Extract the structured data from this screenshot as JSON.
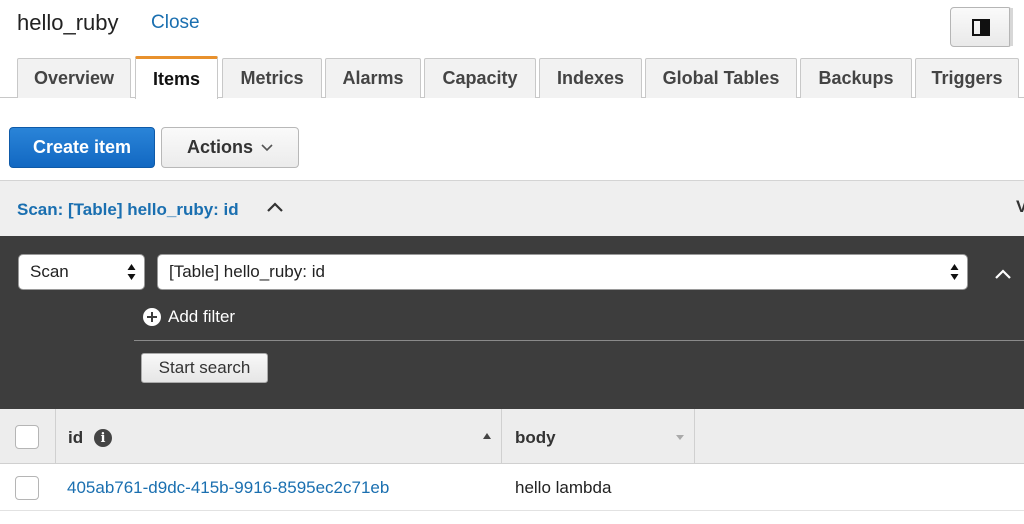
{
  "header": {
    "table_name": "hello_ruby",
    "close_label": "Close"
  },
  "tabs": [
    {
      "label": "Overview"
    },
    {
      "label": "Items",
      "active": true
    },
    {
      "label": "Metrics"
    },
    {
      "label": "Alarms"
    },
    {
      "label": "Capacity"
    },
    {
      "label": "Indexes"
    },
    {
      "label": "Global Tables"
    },
    {
      "label": "Backups"
    },
    {
      "label": "Triggers"
    }
  ],
  "toolbar": {
    "create_label": "Create item",
    "actions_label": "Actions"
  },
  "scan": {
    "summary": "Scan: [Table] hello_ruby: id",
    "edge_glyph": "V",
    "mode_value": "Scan",
    "target_value": "[Table] hello_ruby: id",
    "add_filter_label": "Add filter",
    "start_search_label": "Start search"
  },
  "grid": {
    "columns": [
      {
        "label": "id",
        "sort": "ascending",
        "has_info_icon": true
      },
      {
        "label": "body",
        "sort": "none"
      }
    ],
    "rows": [
      {
        "id": "405ab761-d9dc-415b-9916-8595ec2c71eb",
        "body": "hello lambda"
      }
    ]
  },
  "colors": {
    "primary": "#1a6fb0",
    "active_tab_accent": "#e8912d",
    "panel_dark": "#3d3d3d"
  },
  "icons": [
    "panel-toggle-icon",
    "chevron-down-icon",
    "chevron-up-icon",
    "select-updown-icon",
    "plus-circle-icon",
    "info-icon",
    "sort-ascending-icon",
    "sort-descending-icon"
  ]
}
